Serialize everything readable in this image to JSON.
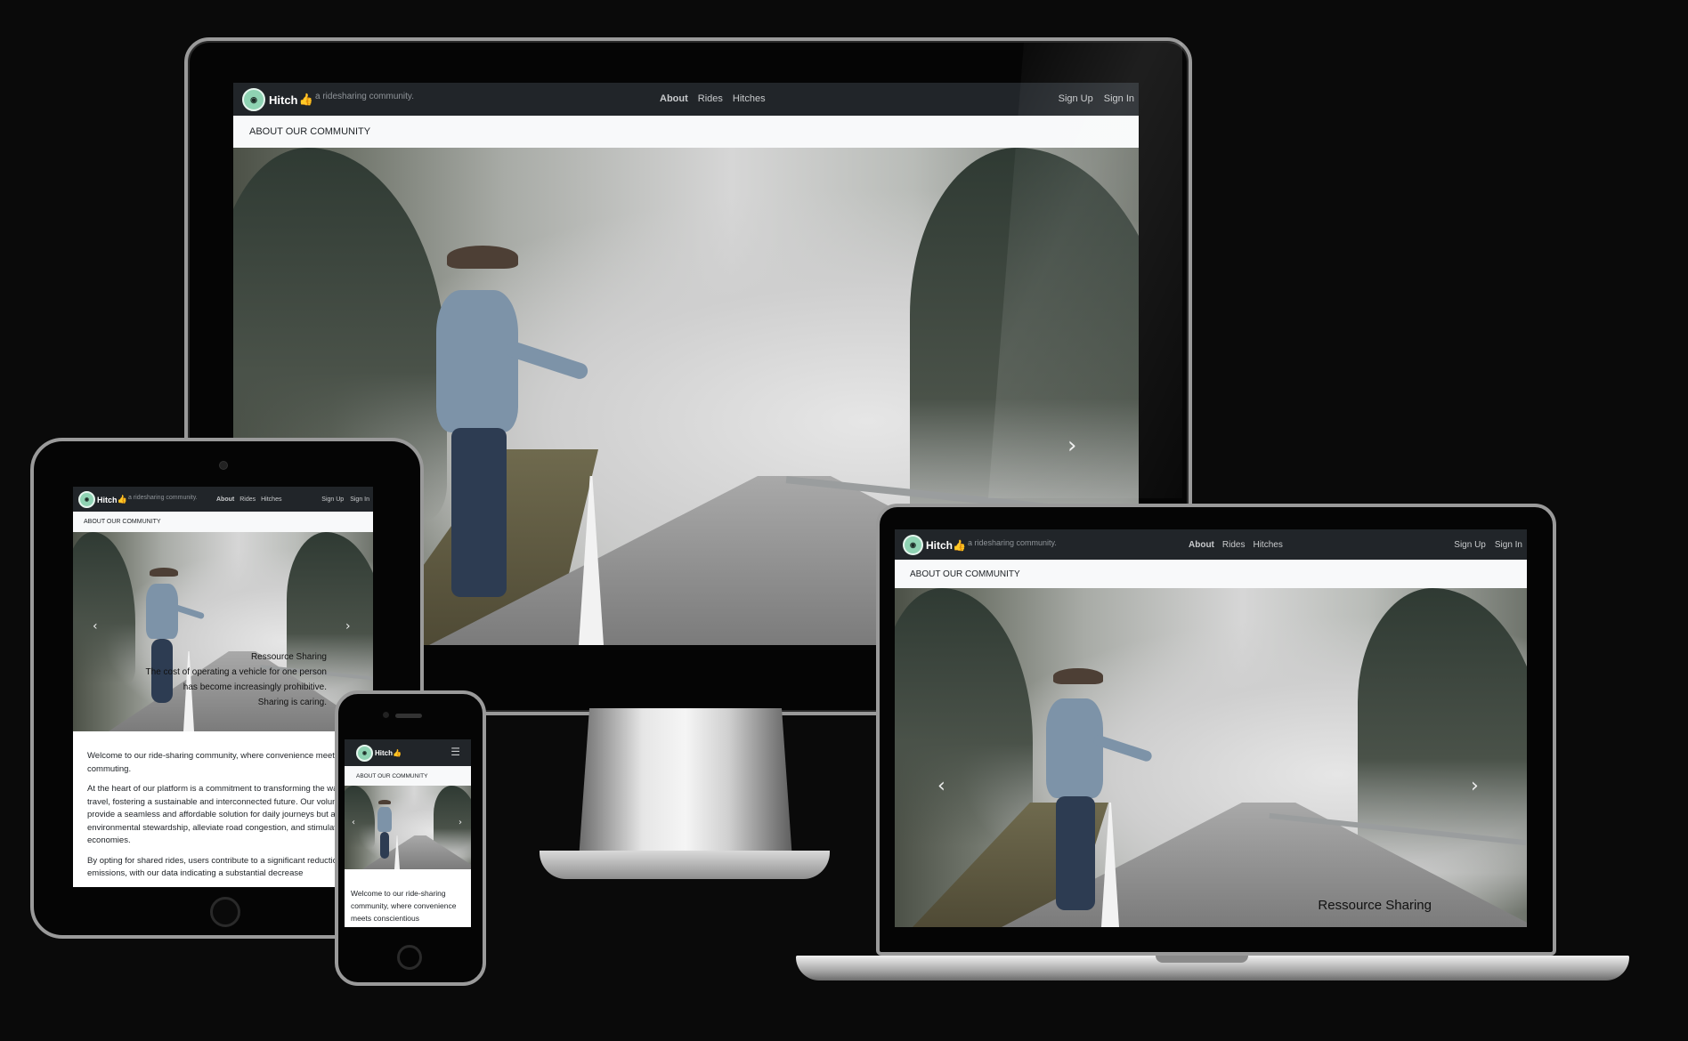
{
  "site": {
    "brand": "Hitch",
    "brand_icon": "thumbs-up-icon",
    "tagline": "a ridesharing community.",
    "nav": {
      "about": "About",
      "rides": "Rides",
      "hitches": "Hitches"
    },
    "auth": {
      "sign_up": "Sign Up",
      "sign_in": "Sign In"
    },
    "section_title": "ABOUT OUR COMMUNITY",
    "hero_prev": "‹",
    "hero_next": "›",
    "caption": {
      "title": "Ressource Sharing",
      "line1": "The cost of operating a vehicle for one person",
      "line2": "has become increasingly prohibitive.",
      "line3": "Sharing is caring."
    },
    "paragraphs": [
      "Welcome to our ride-sharing community, where convenience meets conscientious commuting.",
      "At the heart of our platform is a commitment to transforming the way people travel, fostering a sustainable and interconnected future. Our volunteers not only provide a seamless and affordable solution for daily journeys but also champions environmental stewardship, alleviate road congestion, and stimulate local economies.",
      "By opting for shared rides, users contribute to a significant reduction in carbon emissions, with our data indicating a substantial decrease"
    ],
    "phone_snippet": "Welcome to our ride-sharing community, where convenience meets conscientious"
  },
  "colors": {
    "navbar": "#212529",
    "subbar": "#f8f9fa",
    "logo": "#8fd3b3"
  }
}
